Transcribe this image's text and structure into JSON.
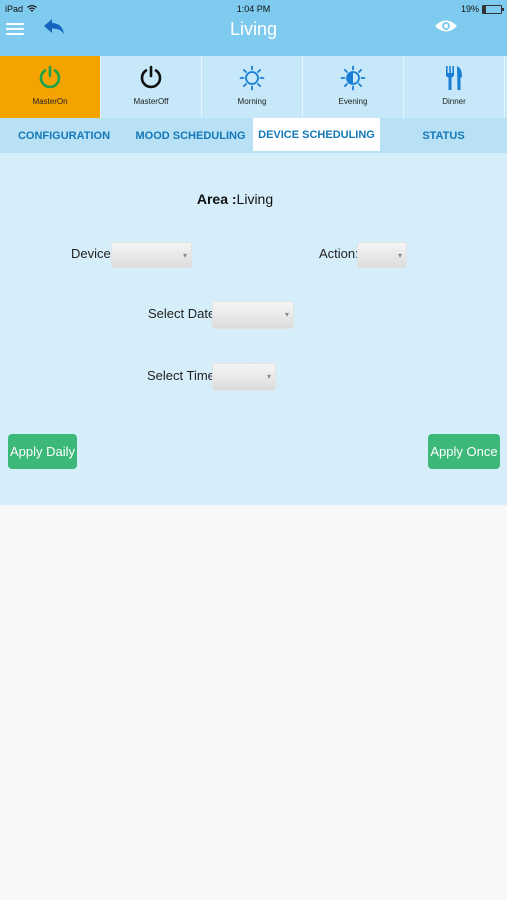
{
  "status_bar": {
    "device": "iPad",
    "time": "1:04 PM",
    "battery": "19%",
    "battery_level": 0.19
  },
  "header": {
    "title": "Living"
  },
  "moods": [
    {
      "label": "MasterOn",
      "icon": "power-icon",
      "active": true
    },
    {
      "label": "MasterOff",
      "icon": "power-icon",
      "active": false
    },
    {
      "label": "Morning",
      "icon": "sun-icon",
      "active": false
    },
    {
      "label": "Evening",
      "icon": "sun-half-icon",
      "active": false
    },
    {
      "label": "Dinner",
      "icon": "fork-knife-icon",
      "active": false
    }
  ],
  "tabs": [
    {
      "label": "CONFIGURATION",
      "active": false
    },
    {
      "label": "MOOD SCHEDULING",
      "active": false
    },
    {
      "label": "DEVICE SCHEDULING",
      "active": true
    },
    {
      "label": "STATUS",
      "active": false
    }
  ],
  "form": {
    "area_label": "Area :",
    "area_value": "Living",
    "device_label": "Device:",
    "device_value": "",
    "action_label": "Action:",
    "action_value": "",
    "date_label": "Select Date:",
    "date_value": "",
    "time_label": "Select Time:",
    "time_value": ""
  },
  "buttons": {
    "apply_daily": "Apply Daily",
    "apply_once": "Apply Once"
  },
  "colors": {
    "header": "#7ecbef",
    "active_mood": "#f5a300",
    "tab_text": "#1478b8",
    "button": "#3cb878",
    "panel": "#d5eefa"
  }
}
